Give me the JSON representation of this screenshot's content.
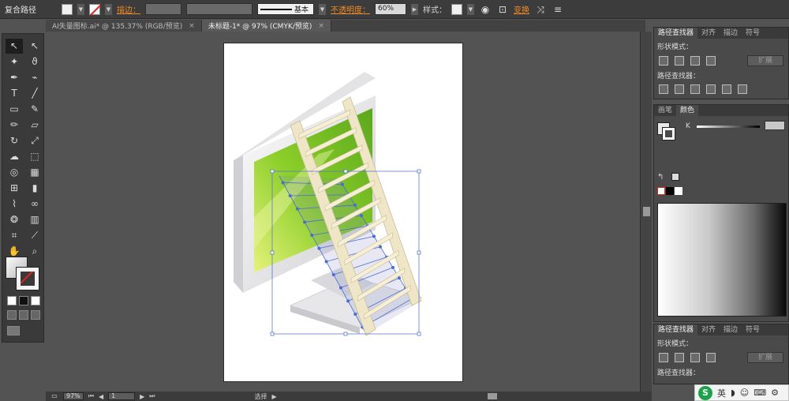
{
  "control_bar": {
    "object_type": "复合路径",
    "stroke_label": "描边：",
    "stroke_profile": "基本",
    "opacity_label": "不透明度：",
    "opacity_value": "60%",
    "style_label": "样式：",
    "transform_label": "变换"
  },
  "tabs": [
    {
      "label": "AI失量图标.ai* @ 135.37% (RGB/预览)",
      "close": "×"
    },
    {
      "label": "未标题-1* @ 97% (CMYK/预览)",
      "close": "×"
    }
  ],
  "tools": [
    {
      "left": "selection-tool",
      "left_glyph": "↖",
      "right": "direct-selection-tool",
      "right_glyph": "↖"
    },
    {
      "left": "magic-wand-tool",
      "left_glyph": "✦",
      "right": "lasso-tool",
      "right_glyph": "ϑ"
    },
    {
      "left": "pen-tool",
      "left_glyph": "✒",
      "right": "curvature-tool",
      "right_glyph": "⌁"
    },
    {
      "left": "type-tool",
      "left_glyph": "T",
      "right": "line-tool",
      "right_glyph": "╱"
    },
    {
      "left": "rectangle-tool",
      "left_glyph": "▭",
      "right": "paintbrush-tool",
      "right_glyph": "✎"
    },
    {
      "left": "pencil-tool",
      "left_glyph": "✏",
      "right": "eraser-tool",
      "right_glyph": "▱"
    },
    {
      "left": "rotate-tool",
      "left_glyph": "↻",
      "right": "scale-tool",
      "right_glyph": "⤢"
    },
    {
      "left": "warp-tool",
      "left_glyph": "☁",
      "right": "free-transform-tool",
      "right_glyph": "⬚"
    },
    {
      "left": "shape-builder-tool",
      "left_glyph": "◎",
      "right": "perspective-grid-tool",
      "right_glyph": "▦"
    },
    {
      "left": "mesh-tool",
      "left_glyph": "⊞",
      "right": "gradient-tool",
      "right_glyph": "▮"
    },
    {
      "left": "eyedropper-tool",
      "left_glyph": "⌇",
      "right": "blend-tool",
      "right_glyph": "∞"
    },
    {
      "left": "symbol-sprayer-tool",
      "left_glyph": "❂",
      "right": "column-graph-tool",
      "right_glyph": "▥"
    },
    {
      "left": "artboard-tool",
      "left_glyph": "⌗",
      "right": "slice-tool",
      "right_glyph": "⟋"
    },
    {
      "left": "hand-tool",
      "left_glyph": "✋",
      "right": "zoom-tool",
      "right_glyph": "⌕"
    }
  ],
  "status_bar": {
    "zoom": "97%",
    "artboard": "1",
    "mode": "选择"
  },
  "pathfinder_panel": {
    "tabs": [
      "路径查找器",
      "对齐",
      "描边",
      "符号"
    ],
    "shape_modes_label": "形状模式：",
    "expand_label": "扩展",
    "pathfinders_label": "路径查找器："
  },
  "color_panel": {
    "tabs": [
      "画笔",
      "颜色"
    ],
    "channel": "K"
  },
  "ime": {
    "logo": "S",
    "lang": "英"
  }
}
